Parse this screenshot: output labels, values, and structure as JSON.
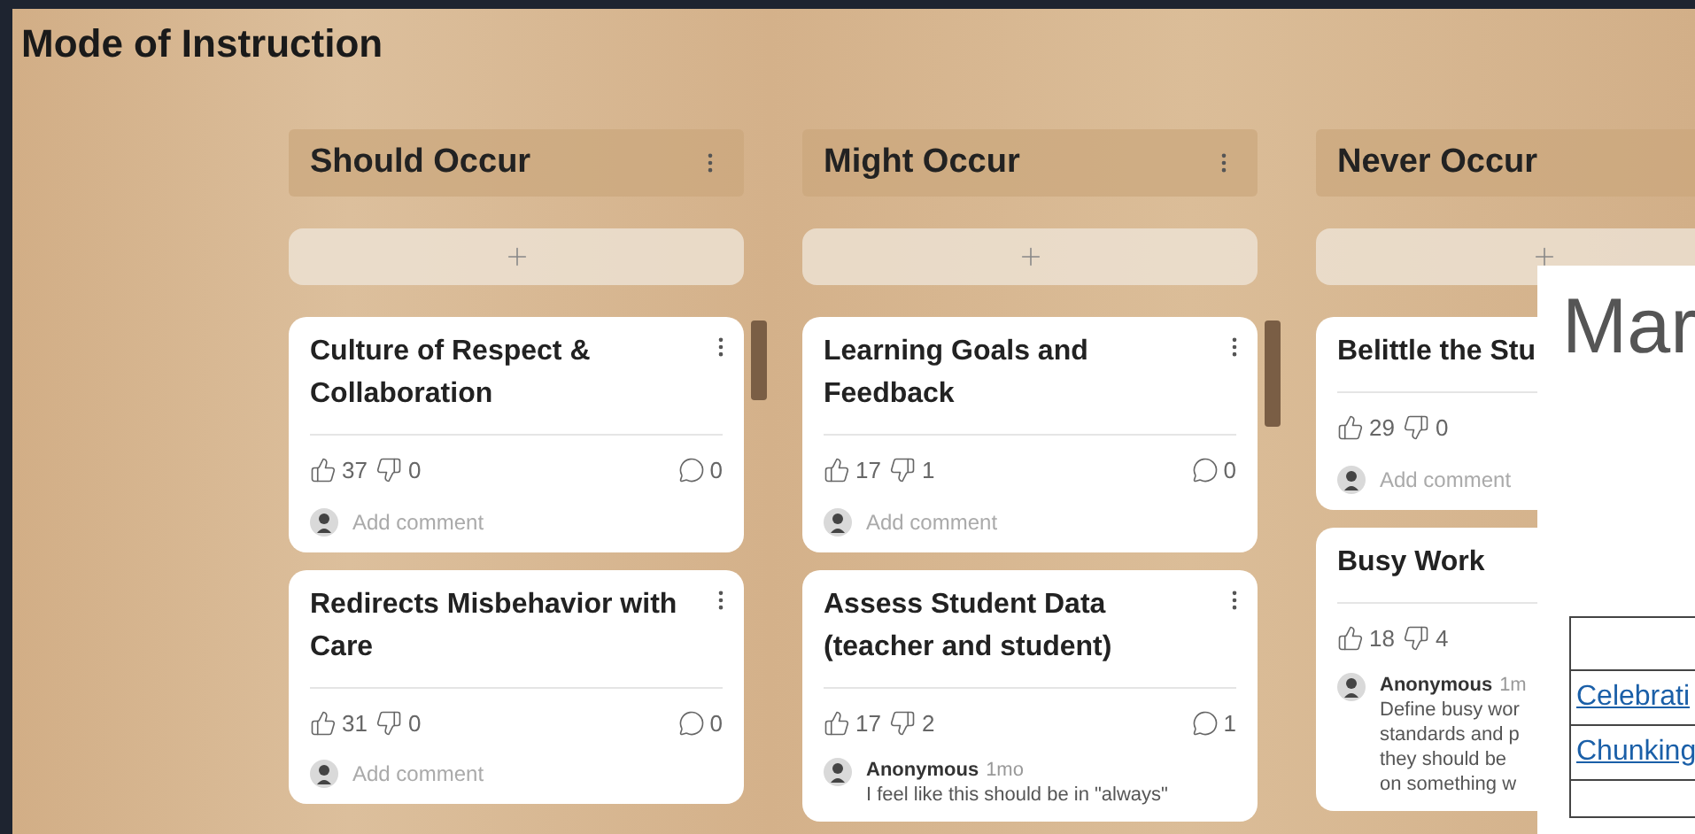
{
  "board": {
    "title": "Mode of Instruction"
  },
  "columns": [
    {
      "title": "Should Occur",
      "cards": [
        {
          "title": "Culture of Respect & Collaboration",
          "likes": "37",
          "dislikes": "0",
          "comment_count": "0",
          "comment": {
            "kind": "prompt",
            "placeholder": "Add comment"
          }
        },
        {
          "title": "Redirects Misbehavior with Care",
          "likes": "31",
          "dislikes": "0",
          "comment_count": "0",
          "comment": {
            "kind": "prompt",
            "placeholder": "Add comment"
          }
        }
      ]
    },
    {
      "title": "Might Occur",
      "cards": [
        {
          "title": "Learning Goals and Feedback",
          "likes": "17",
          "dislikes": "1",
          "comment_count": "0",
          "comment": {
            "kind": "prompt",
            "placeholder": "Add comment"
          }
        },
        {
          "title": "Assess Student Data (teacher and student)",
          "likes": "17",
          "dislikes": "2",
          "comment_count": "1",
          "comment": {
            "kind": "comment",
            "author": "Anonymous",
            "time": "1mo",
            "lines": [
              "I feel like this should be in \"always\""
            ]
          }
        }
      ]
    },
    {
      "title": "Never Occur",
      "cards": [
        {
          "title": "Belittle the Stu",
          "likes": "29",
          "dislikes": "0",
          "comment": {
            "kind": "prompt",
            "placeholder": "Add comment"
          }
        },
        {
          "title": "Busy Work",
          "likes": "18",
          "dislikes": "4",
          "comment": {
            "kind": "comment",
            "author": "Anonymous",
            "time": "1m",
            "lines": [
              "Define busy wor",
              "standards and p",
              "they should be",
              "on something w"
            ]
          }
        }
      ]
    }
  ],
  "document": {
    "heading": "Mar",
    "links": [
      "Celebrati",
      "Chunking"
    ]
  }
}
